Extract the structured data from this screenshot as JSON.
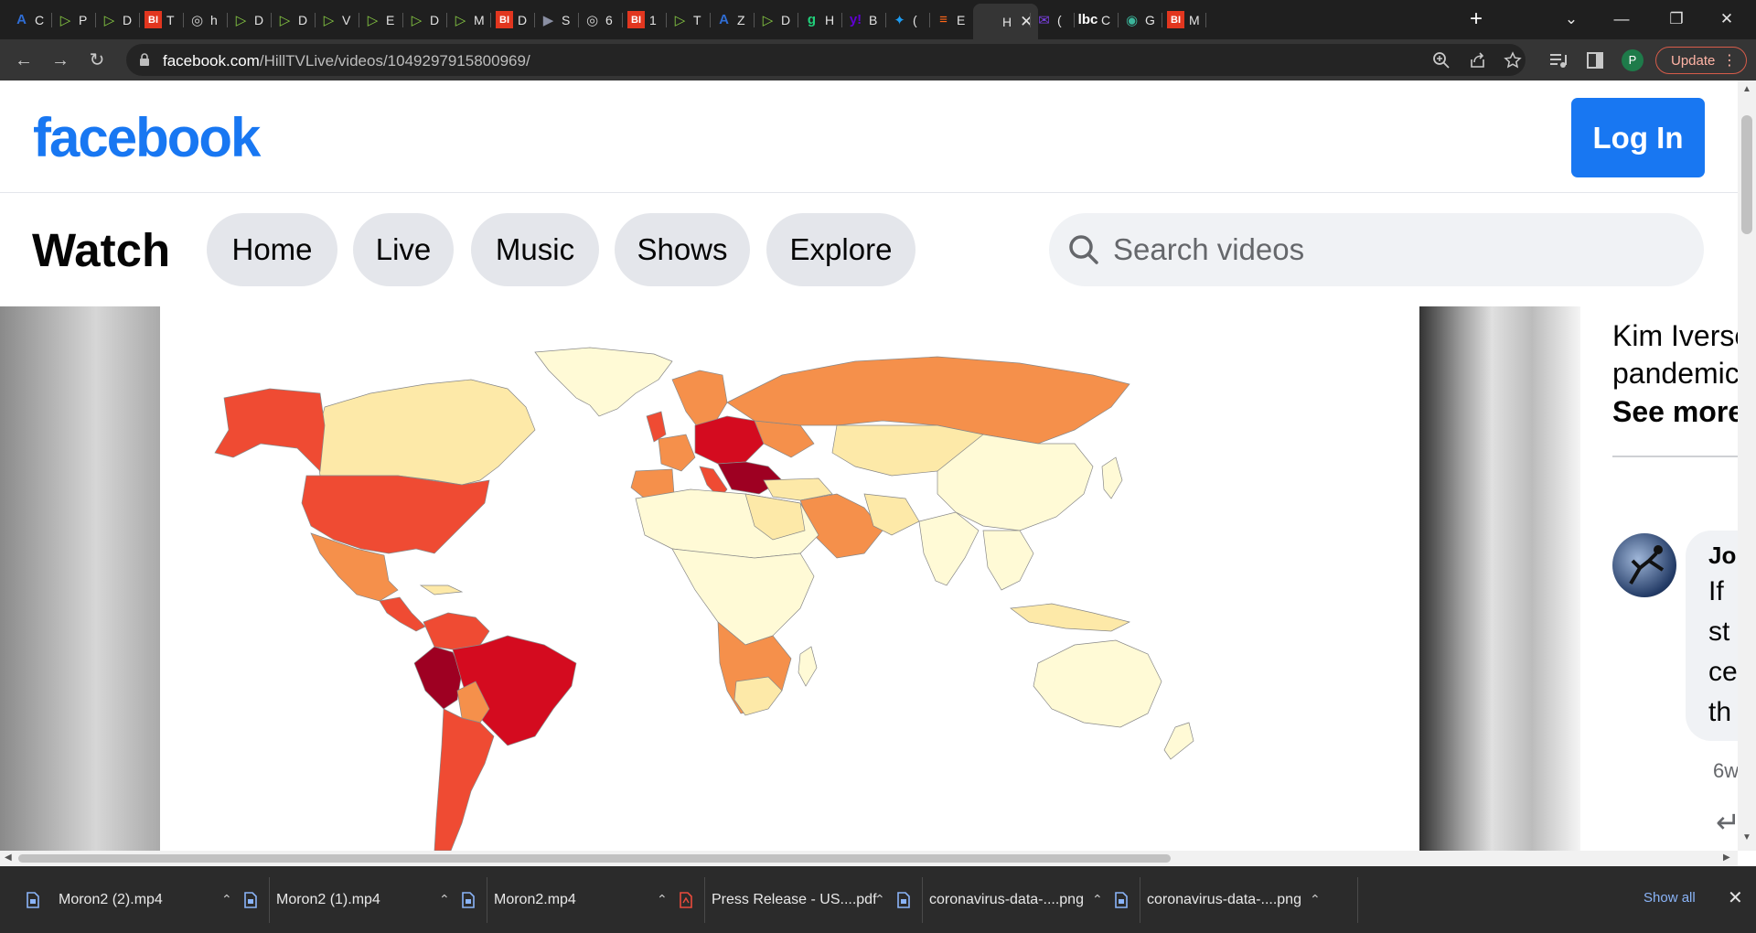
{
  "browser": {
    "tabs": [
      {
        "icon": "atlantic-icon",
        "label": "C"
      },
      {
        "icon": "rumble-icon",
        "label": "P"
      },
      {
        "icon": "rumble-icon",
        "label": "D"
      },
      {
        "icon": "business-insider-icon",
        "label": "T"
      },
      {
        "icon": "globe-icon",
        "label": "h"
      },
      {
        "icon": "rumble-icon",
        "label": "D"
      },
      {
        "icon": "rumble-icon",
        "label": "D"
      },
      {
        "icon": "rumble-icon",
        "label": "V"
      },
      {
        "icon": "rumble-icon",
        "label": "E"
      },
      {
        "icon": "rumble-icon",
        "label": "D"
      },
      {
        "icon": "rumble-icon",
        "label": "M"
      },
      {
        "icon": "business-insider-icon",
        "label": "D"
      },
      {
        "icon": "substack-icon",
        "label": "S"
      },
      {
        "icon": "globe-icon",
        "label": "6"
      },
      {
        "icon": "business-insider-icon",
        "label": "1"
      },
      {
        "icon": "rumble-icon",
        "label": "T"
      },
      {
        "icon": "atlantic-icon",
        "label": "Z"
      },
      {
        "icon": "rumble-icon",
        "label": "D"
      },
      {
        "icon": "gab-icon",
        "label": "H"
      },
      {
        "icon": "yahoo-icon",
        "label": "B"
      },
      {
        "icon": "twitter-icon",
        "label": "("
      },
      {
        "icon": "bookmark-icon",
        "label": "E"
      },
      {
        "icon": "hill-icon",
        "label": "H",
        "active": true
      },
      {
        "icon": "mail-icon",
        "label": "("
      },
      {
        "icon": "lbc-icon",
        "label": "C"
      },
      {
        "icon": "green-globe-icon",
        "label": "G"
      },
      {
        "icon": "business-insider-icon",
        "label": "M"
      }
    ],
    "url_domain": "facebook.com",
    "url_path": "/HillTVLive/videos/1049297915800969/",
    "profile_initial": "P",
    "update_label": "Update",
    "colors": {
      "accent": "#1877f2",
      "update": "#d65c4a"
    }
  },
  "header": {
    "logo": "facebook",
    "login_label": "Log In"
  },
  "watch": {
    "title": "Watch",
    "nav": [
      "Home",
      "Live",
      "Music",
      "Shows",
      "Explore"
    ],
    "search_placeholder": "Search videos"
  },
  "video": {
    "map_legend_colors": [
      "#fffad6",
      "#fde9a8",
      "#f5904b",
      "#ef4b33",
      "#d40b1f",
      "#9e0022"
    ]
  },
  "side": {
    "desc_line1": "Kim Iverse",
    "desc_line2": "pandemic",
    "see_more": "See more",
    "comment_author": "Jo",
    "comment_lines": [
      "If",
      "st",
      "ce",
      "th"
    ],
    "comment_time": "6w"
  },
  "downloads": {
    "items": [
      {
        "name": "Moron2 (2).mp4",
        "icon": "doc-icon"
      },
      {
        "name": "Moron2 (1).mp4",
        "icon": "doc-icon"
      },
      {
        "name": "Moron2.mp4",
        "icon": "doc-icon"
      },
      {
        "name": "Press Release - US....pdf",
        "icon": "pdf-icon"
      },
      {
        "name": "coronavirus-data-....png",
        "icon": "doc-icon"
      },
      {
        "name": "coronavirus-data-....png",
        "icon": "doc-icon"
      }
    ],
    "show_all": "Show all"
  }
}
